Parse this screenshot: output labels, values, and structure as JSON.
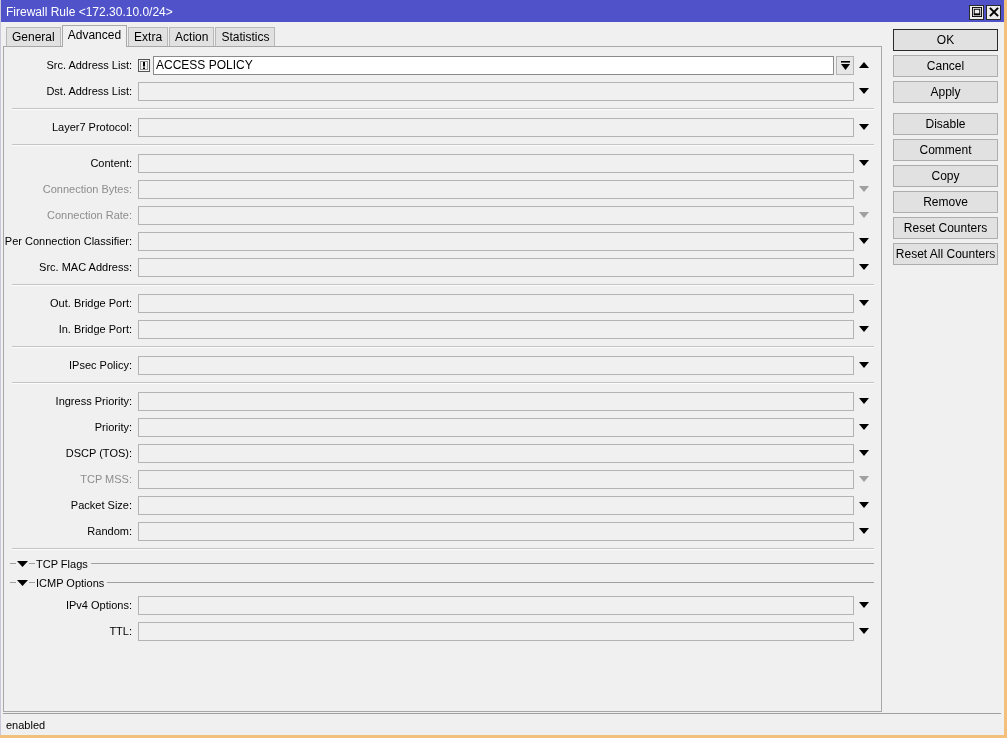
{
  "window": {
    "title": "Firewall Rule <172.30.10.0/24>"
  },
  "tabs": [
    {
      "label": "General",
      "selected": false
    },
    {
      "label": "Advanced",
      "selected": true
    },
    {
      "label": "Extra",
      "selected": false
    },
    {
      "label": "Action",
      "selected": false
    },
    {
      "label": "Statistics",
      "selected": false
    }
  ],
  "form": {
    "sections": [
      {
        "kind": "group",
        "fields": [
          {
            "label": "Src. Address List:",
            "active": true,
            "disabled": false,
            "value": "ACCESS POLICY"
          },
          {
            "label": "Dst. Address List:",
            "active": false,
            "disabled": false
          }
        ]
      },
      {
        "kind": "group",
        "fields": [
          {
            "label": "Layer7 Protocol:",
            "active": false,
            "disabled": false
          }
        ]
      },
      {
        "kind": "group",
        "fields": [
          {
            "label": "Content:",
            "active": false,
            "disabled": false
          },
          {
            "label": "Connection Bytes:",
            "active": false,
            "disabled": true
          },
          {
            "label": "Connection Rate:",
            "active": false,
            "disabled": true
          },
          {
            "label": "Per Connection Classifier:",
            "active": false,
            "disabled": false
          },
          {
            "label": "Src. MAC Address:",
            "active": false,
            "disabled": false
          }
        ]
      },
      {
        "kind": "group",
        "fields": [
          {
            "label": "Out. Bridge Port:",
            "active": false,
            "disabled": false
          },
          {
            "label": "In. Bridge Port:",
            "active": false,
            "disabled": false
          }
        ]
      },
      {
        "kind": "group",
        "fields": [
          {
            "label": "IPsec Policy:",
            "active": false,
            "disabled": false
          }
        ]
      },
      {
        "kind": "group",
        "fields": [
          {
            "label": "Ingress Priority:",
            "active": false,
            "disabled": false
          },
          {
            "label": "Priority:",
            "active": false,
            "disabled": false
          },
          {
            "label": "DSCP (TOS):",
            "active": false,
            "disabled": false
          },
          {
            "label": "TCP MSS:",
            "active": false,
            "disabled": true
          },
          {
            "label": "Packet Size:",
            "active": false,
            "disabled": false
          },
          {
            "label": "Random:",
            "active": false,
            "disabled": false
          }
        ]
      },
      {
        "kind": "collapsible",
        "label": "TCP Flags",
        "expanded": false
      },
      {
        "kind": "collapsible",
        "label": "ICMP Options",
        "expanded": false
      },
      {
        "kind": "group",
        "fields": [
          {
            "label": "IPv4 Options:",
            "active": false,
            "disabled": false
          },
          {
            "label": "TTL:",
            "active": false,
            "disabled": false
          }
        ]
      }
    ]
  },
  "button_groups": [
    [
      {
        "label": "OK",
        "default": true
      },
      {
        "label": "Cancel",
        "default": false
      },
      {
        "label": "Apply",
        "default": false
      }
    ],
    [
      {
        "label": "Disable",
        "default": false
      },
      {
        "label": "Comment",
        "default": false
      },
      {
        "label": "Copy",
        "default": false
      },
      {
        "label": "Remove",
        "default": false
      },
      {
        "label": "Reset Counters",
        "default": false
      },
      {
        "label": "Reset All Counters",
        "default": false
      }
    ]
  ],
  "status_bar": {
    "text": "enabled"
  }
}
